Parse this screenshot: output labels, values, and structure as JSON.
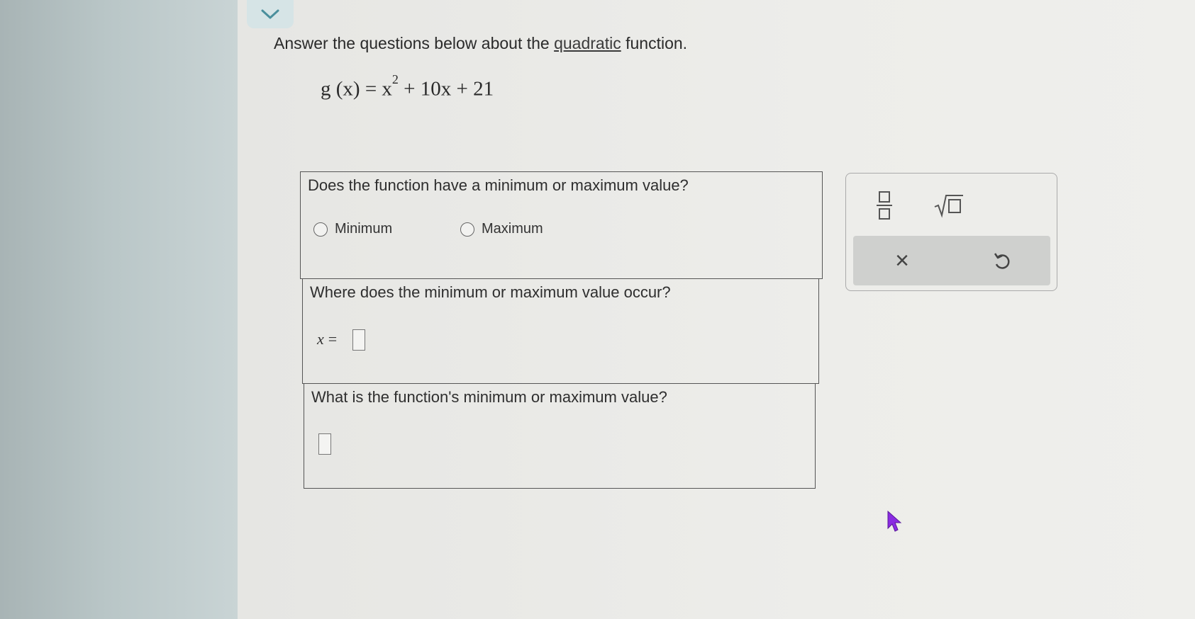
{
  "instruction": {
    "before": "Answer the questions below about the ",
    "link": "quadratic",
    "after": " function."
  },
  "equation": {
    "lhs": "g (x) = x",
    "exp": "2",
    "rhs": " + 10x + 21"
  },
  "questions": {
    "q1": {
      "text": "Does the function have a minimum or maximum value?",
      "options": [
        "Minimum",
        "Maximum"
      ]
    },
    "q2": {
      "text": "Where does the minimum or maximum value occur?",
      "var": "x",
      "eq": "="
    },
    "q3": {
      "text": "What is the function's minimum or maximum value?"
    }
  },
  "toolbox": {
    "clear_symbol": "×",
    "tools": [
      "fraction-icon",
      "sqrt-icon",
      "clear-icon",
      "undo-icon"
    ]
  },
  "colors": {
    "accent": "#5a9aa6",
    "cursor": "#8a2be2"
  }
}
